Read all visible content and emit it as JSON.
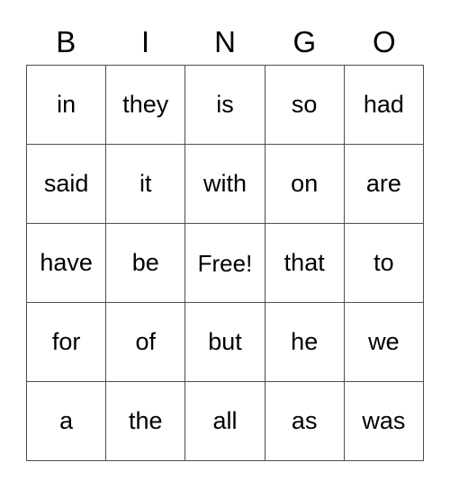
{
  "card": {
    "title": "BINGO",
    "headers": [
      "B",
      "I",
      "N",
      "G",
      "O"
    ],
    "free_space_label": "Free!",
    "free_space_index": {
      "row": 2,
      "col": 2
    },
    "grid_size": "5x5",
    "colors": {
      "background": "#ffffff",
      "text": "#000000",
      "border": "#4d4d4d"
    },
    "rows": [
      {
        "cells": [
          "in",
          "they",
          "is",
          "so",
          "had"
        ]
      },
      {
        "cells": [
          "said",
          "it",
          "with",
          "on",
          "are"
        ]
      },
      {
        "cells": [
          "have",
          "be",
          "Free!",
          "that",
          "to"
        ]
      },
      {
        "cells": [
          "for",
          "of",
          "but",
          "he",
          "we"
        ]
      },
      {
        "cells": [
          "a",
          "the",
          "all",
          "as",
          "was"
        ]
      }
    ]
  }
}
